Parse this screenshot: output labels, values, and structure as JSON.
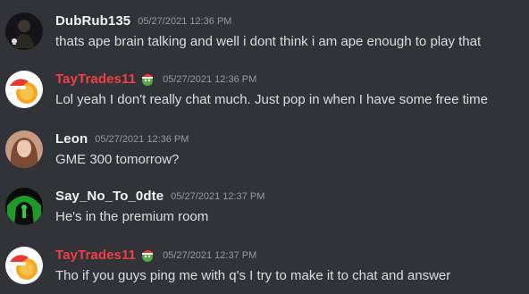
{
  "messages": [
    {
      "username": "DubRub135",
      "username_color": "#f2f3f5",
      "timestamp": "05/27/2021 12:36 PM",
      "text": "thats ape brain talking and well i dont think i am ape enough to play that",
      "avatar": "dark-figure-avatar"
    },
    {
      "username": "TayTrades11",
      "username_color": "#f23f43",
      "timestamp": "05/27/2021 12:36 PM",
      "text": "Lol yeah I don't really chat much. Just pop in when I have some free time",
      "avatar": "santa-hat-coin-avatar",
      "badge": "pepe-santa-emoji"
    },
    {
      "username": "Leon",
      "username_color": "#f2f3f5",
      "timestamp": "05/27/2021 12:36 PM",
      "text": "GME 300 tomorrow?",
      "avatar": "portrait-avatar"
    },
    {
      "username": "Say_No_To_0dte",
      "username_color": "#f2f3f5",
      "timestamp": "05/27/2021 12:37 PM",
      "text": "He's in the premium room",
      "avatar": "green-hooded-figure-avatar"
    },
    {
      "username": "TayTrades11",
      "username_color": "#f23f43",
      "timestamp": "05/27/2021 12:37 PM",
      "text": "Tho if you guys ping me with q's I try to make it to chat and answer",
      "avatar": "santa-hat-coin-avatar",
      "badge": "pepe-santa-emoji"
    }
  ]
}
